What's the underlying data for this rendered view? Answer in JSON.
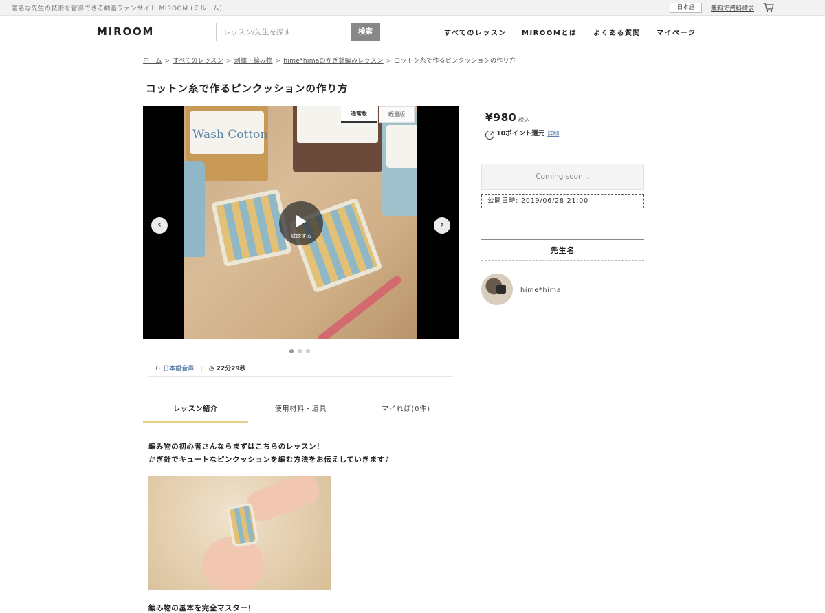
{
  "topbar": {
    "tagline": "著名な先生の技術を習得できる動画ファンサイト MIROOM (ミルーム)",
    "language": "日本語",
    "request": "無料で資料請求",
    "cart_icon": "cart-icon"
  },
  "header": {
    "logo": "MIROOM",
    "search_placeholder": "レッスン/先生を探す",
    "search_button": "検索",
    "nav": [
      "すべてのレッスン",
      "MIROOMとは",
      "よくある質問",
      "マイページ"
    ]
  },
  "breadcrumb": [
    "ホーム",
    "すべてのレッスン",
    "刺繍・編み物",
    "hime*himaのかぎ針編みレッスン",
    "コットン糸で作るピンクッションの作り方"
  ],
  "page_title": "コットン糸で作るピンクッションの作り方",
  "video": {
    "version_normal": "通常版",
    "version_light": "軽量版",
    "play_label": "試聴する",
    "yarn_label": "Wash Cotton",
    "prev_icon": "chevron-left-icon",
    "next_icon": "chevron-right-icon",
    "slide_count": 3,
    "active_slide": 1
  },
  "meta": {
    "audio": "日本語音声",
    "separator": "|",
    "duration": "22分29秒",
    "headphones_icon": "headphones-icon",
    "clock_icon": "clock-icon"
  },
  "tabs": [
    "レッスン紹介",
    "使用材料・道具",
    "マイれぽ(0件)"
  ],
  "intro": {
    "line1": "編み物の初心者さんならまずはこちらのレッスン！",
    "line2": "かぎ針でキュートなピンクッションを編む方法をお伝えしていきます♪",
    "line3": "編み物の基本を完全マスター！"
  },
  "purchase": {
    "price": "¥980",
    "tax": "税込",
    "points_icon": "P",
    "points": "10ポイント還元",
    "detail": "詳細",
    "coming_soon": "Coming soon...",
    "publish_date": "公開日時: 2019/06/28 21:00"
  },
  "teacher": {
    "heading": "先生名",
    "name": "hime*hima"
  },
  "colors": {
    "accent_tab": "#e5d08a",
    "link": "#5b7fa8",
    "search_button": "#888888"
  }
}
